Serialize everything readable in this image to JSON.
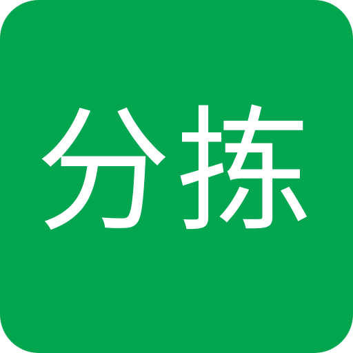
{
  "app_icon": {
    "label": "分拣",
    "background_color": "#02A651",
    "text_color": "#FFFFFF"
  }
}
